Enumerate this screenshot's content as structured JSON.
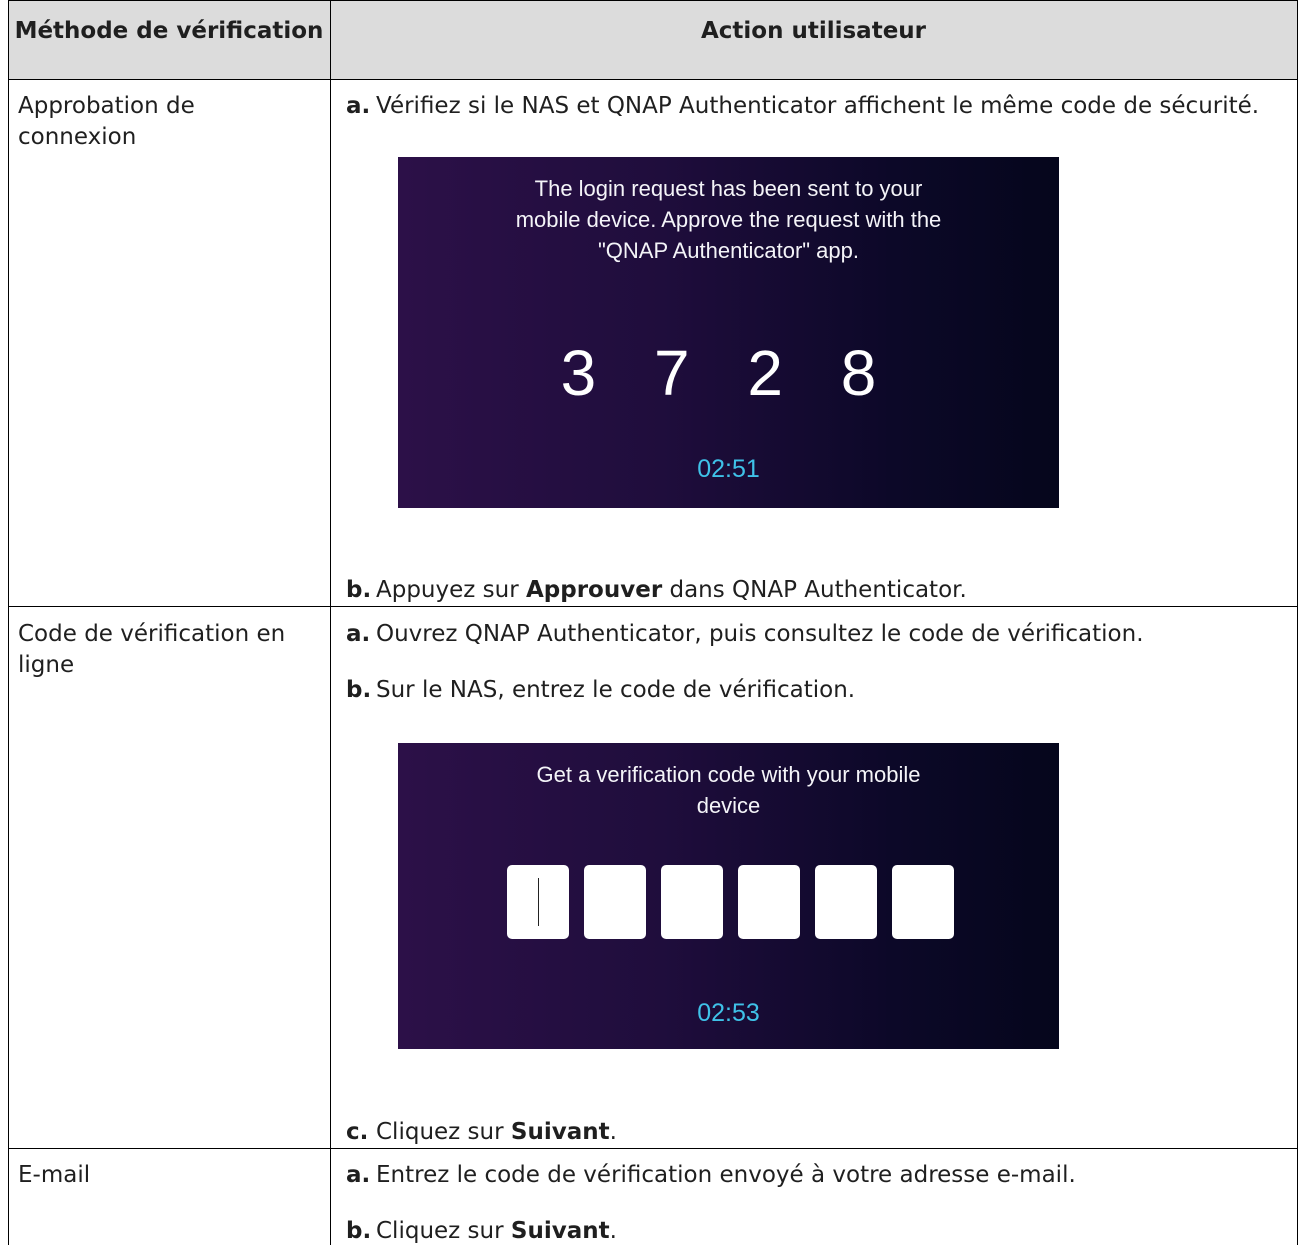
{
  "table": {
    "headers": {
      "method": "Méthode de vérification",
      "action": "Action utilisateur"
    },
    "rows": [
      {
        "method": "Approbation de connexion",
        "steps": [
          {
            "label": "a.",
            "text": "Vérifiez si le NAS et QNAP Authenticator affichent le même code de sécurité."
          },
          {
            "label": "b.",
            "before": "Appuyez sur ",
            "bold": "Approuver",
            "after": " dans QNAP Authenticator."
          }
        ],
        "screenshot": {
          "message": "The login request has been sent to your mobile device. Approve the request with the \"QNAP Authenticator\" app.",
          "message_lines": [
            "The login request has been sent to your",
            "mobile device. Approve the request with the",
            "\"QNAP Authenticator\" app."
          ],
          "code": "3 7 2 8",
          "timer": "02:51"
        }
      },
      {
        "method": "Code de vérification en ligne",
        "steps": [
          {
            "label": "a.",
            "text": "Ouvrez QNAP Authenticator, puis consultez le code de vérification."
          },
          {
            "label": "b.",
            "text": "Sur le NAS, entrez le code de vérification."
          },
          {
            "label": "c.",
            "before": "Cliquez sur ",
            "bold": "Suivant",
            "after": "."
          }
        ],
        "screenshot": {
          "message": "Get a verification code with your mobile device",
          "message_lines": [
            "Get a verification code with your mobile",
            "device"
          ],
          "digit_boxes": 6,
          "timer": "02:53"
        }
      },
      {
        "method": "E-mail",
        "steps": [
          {
            "label": "a.",
            "text": "Entrez le code de vérification envoyé à votre adresse e-mail."
          },
          {
            "label": "b.",
            "before": "Cliquez sur ",
            "bold": "Suivant",
            "after": "."
          }
        ]
      }
    ]
  }
}
